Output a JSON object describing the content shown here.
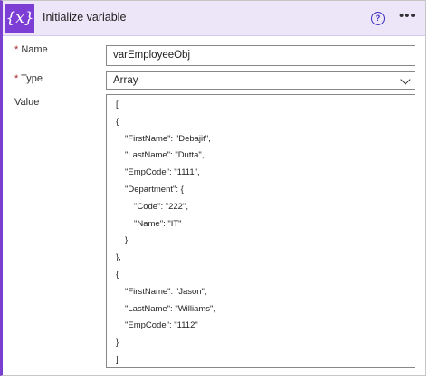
{
  "card": {
    "icon_text": "{x}",
    "title": "Initialize variable",
    "help_icon": "question-circle-icon",
    "more_icon": "ellipsis-icon"
  },
  "fields": {
    "name_required_mark": "*",
    "name_label": "Name",
    "name_value": "varEmployeeObj",
    "type_required_mark": "*",
    "type_label": "Type",
    "type_value": "Array",
    "value_label": "Value"
  },
  "value_lines": [
    "[",
    "{",
    "  \"FirstName\": \"Debajit\",",
    "  \"LastName\": \"Dutta\",",
    "  \"EmpCode\": \"1111\",",
    "  \"Department\": {",
    "    \"Code\": \"222\",",
    "    \"Name\": \"IT\"",
    "  }",
    "},",
    "{",
    "  \"FirstName\": \"Jason\",",
    "  \"LastName\": \"Williams\",",
    "  \"EmpCode\": \"1112\"",
    "}",
    "]"
  ],
  "colors": {
    "accent": "#7c3ed4",
    "header_bg": "#ece6f8",
    "required": "#a4262c"
  }
}
